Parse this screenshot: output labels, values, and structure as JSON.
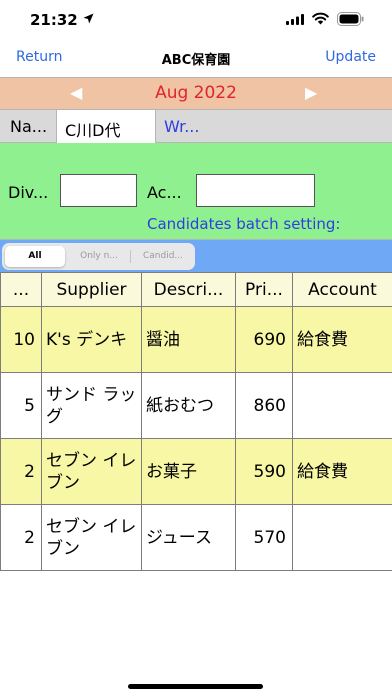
{
  "status": {
    "time": "21:32"
  },
  "nav": {
    "back": "Return",
    "title": "ABC保育園",
    "action": "Update"
  },
  "month": {
    "prev": "◀",
    "label": "Aug 2022",
    "next": "▶"
  },
  "name_row": {
    "label": "Na...",
    "value": "C川D代",
    "write": "Wr..."
  },
  "batch": {
    "div_label": "Div...",
    "div_value": "",
    "account_label": "Ac...",
    "account_value": "",
    "link": "Candidates batch setting:"
  },
  "filters": [
    {
      "label": "All",
      "selected": true
    },
    {
      "label": "Only n...",
      "selected": false
    },
    {
      "label": "Candid...",
      "selected": false
    }
  ],
  "table": {
    "headers": [
      "...",
      "Supplier",
      "Descri...",
      "Pri...",
      "Account"
    ],
    "rows": [
      {
        "qty": "10",
        "supplier": "K's デンキ",
        "description": "醤油",
        "price": "690",
        "account": "給食費",
        "highlight": true
      },
      {
        "qty": "5",
        "supplier": "サンド ラッグ",
        "description": "紙おむつ",
        "price": "860",
        "account": "",
        "highlight": false
      },
      {
        "qty": "2",
        "supplier": "セブン イレブン",
        "description": "お菓子",
        "price": "590",
        "account": "給食費",
        "highlight": true
      },
      {
        "qty": "2",
        "supplier": "セブン イレブン",
        "description": "ジュース",
        "price": "570",
        "account": "",
        "highlight": false
      }
    ]
  },
  "colors": {
    "link": "#2f6ae0",
    "month_bar": "#efc3a3",
    "month_text": "#e1242a",
    "batch_panel": "#8ff08f",
    "filter_bar": "#6fa8f5",
    "row_highlight": "#f8f7a6",
    "header_bg": "#fafadb"
  },
  "icons": [
    "location-arrow-icon",
    "cellular-signal-icon",
    "wifi-icon",
    "battery-icon"
  ]
}
